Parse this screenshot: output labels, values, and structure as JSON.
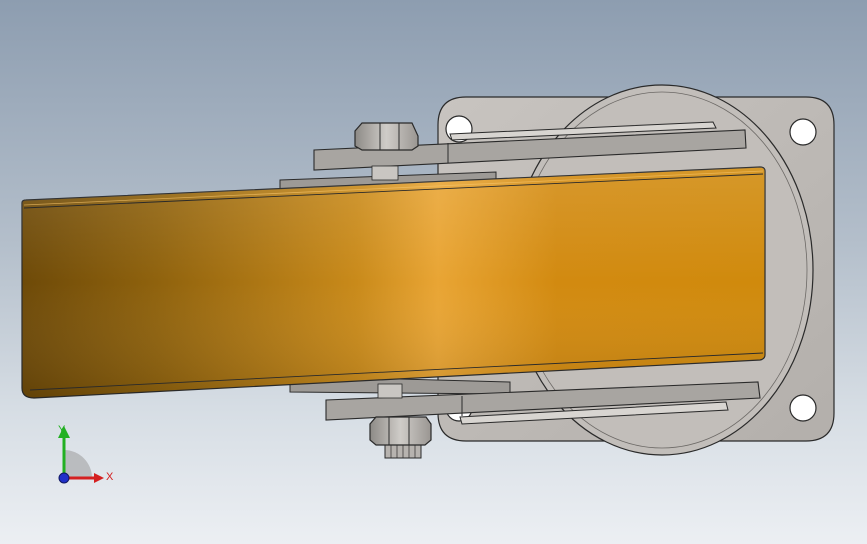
{
  "view": {
    "background_top": "#8d9db0",
    "background_bottom": "#eceff3"
  },
  "model": {
    "wheel_color": "#e0961c",
    "plate_color": "#b9b5b1",
    "bracket_color": "#a9a6a2",
    "edge_color": "#2a2a2a"
  },
  "triad": {
    "x_label": "X",
    "y_label": "Y",
    "x_color": "#d42020",
    "y_color": "#22b022",
    "z_color": "#2030c8"
  }
}
